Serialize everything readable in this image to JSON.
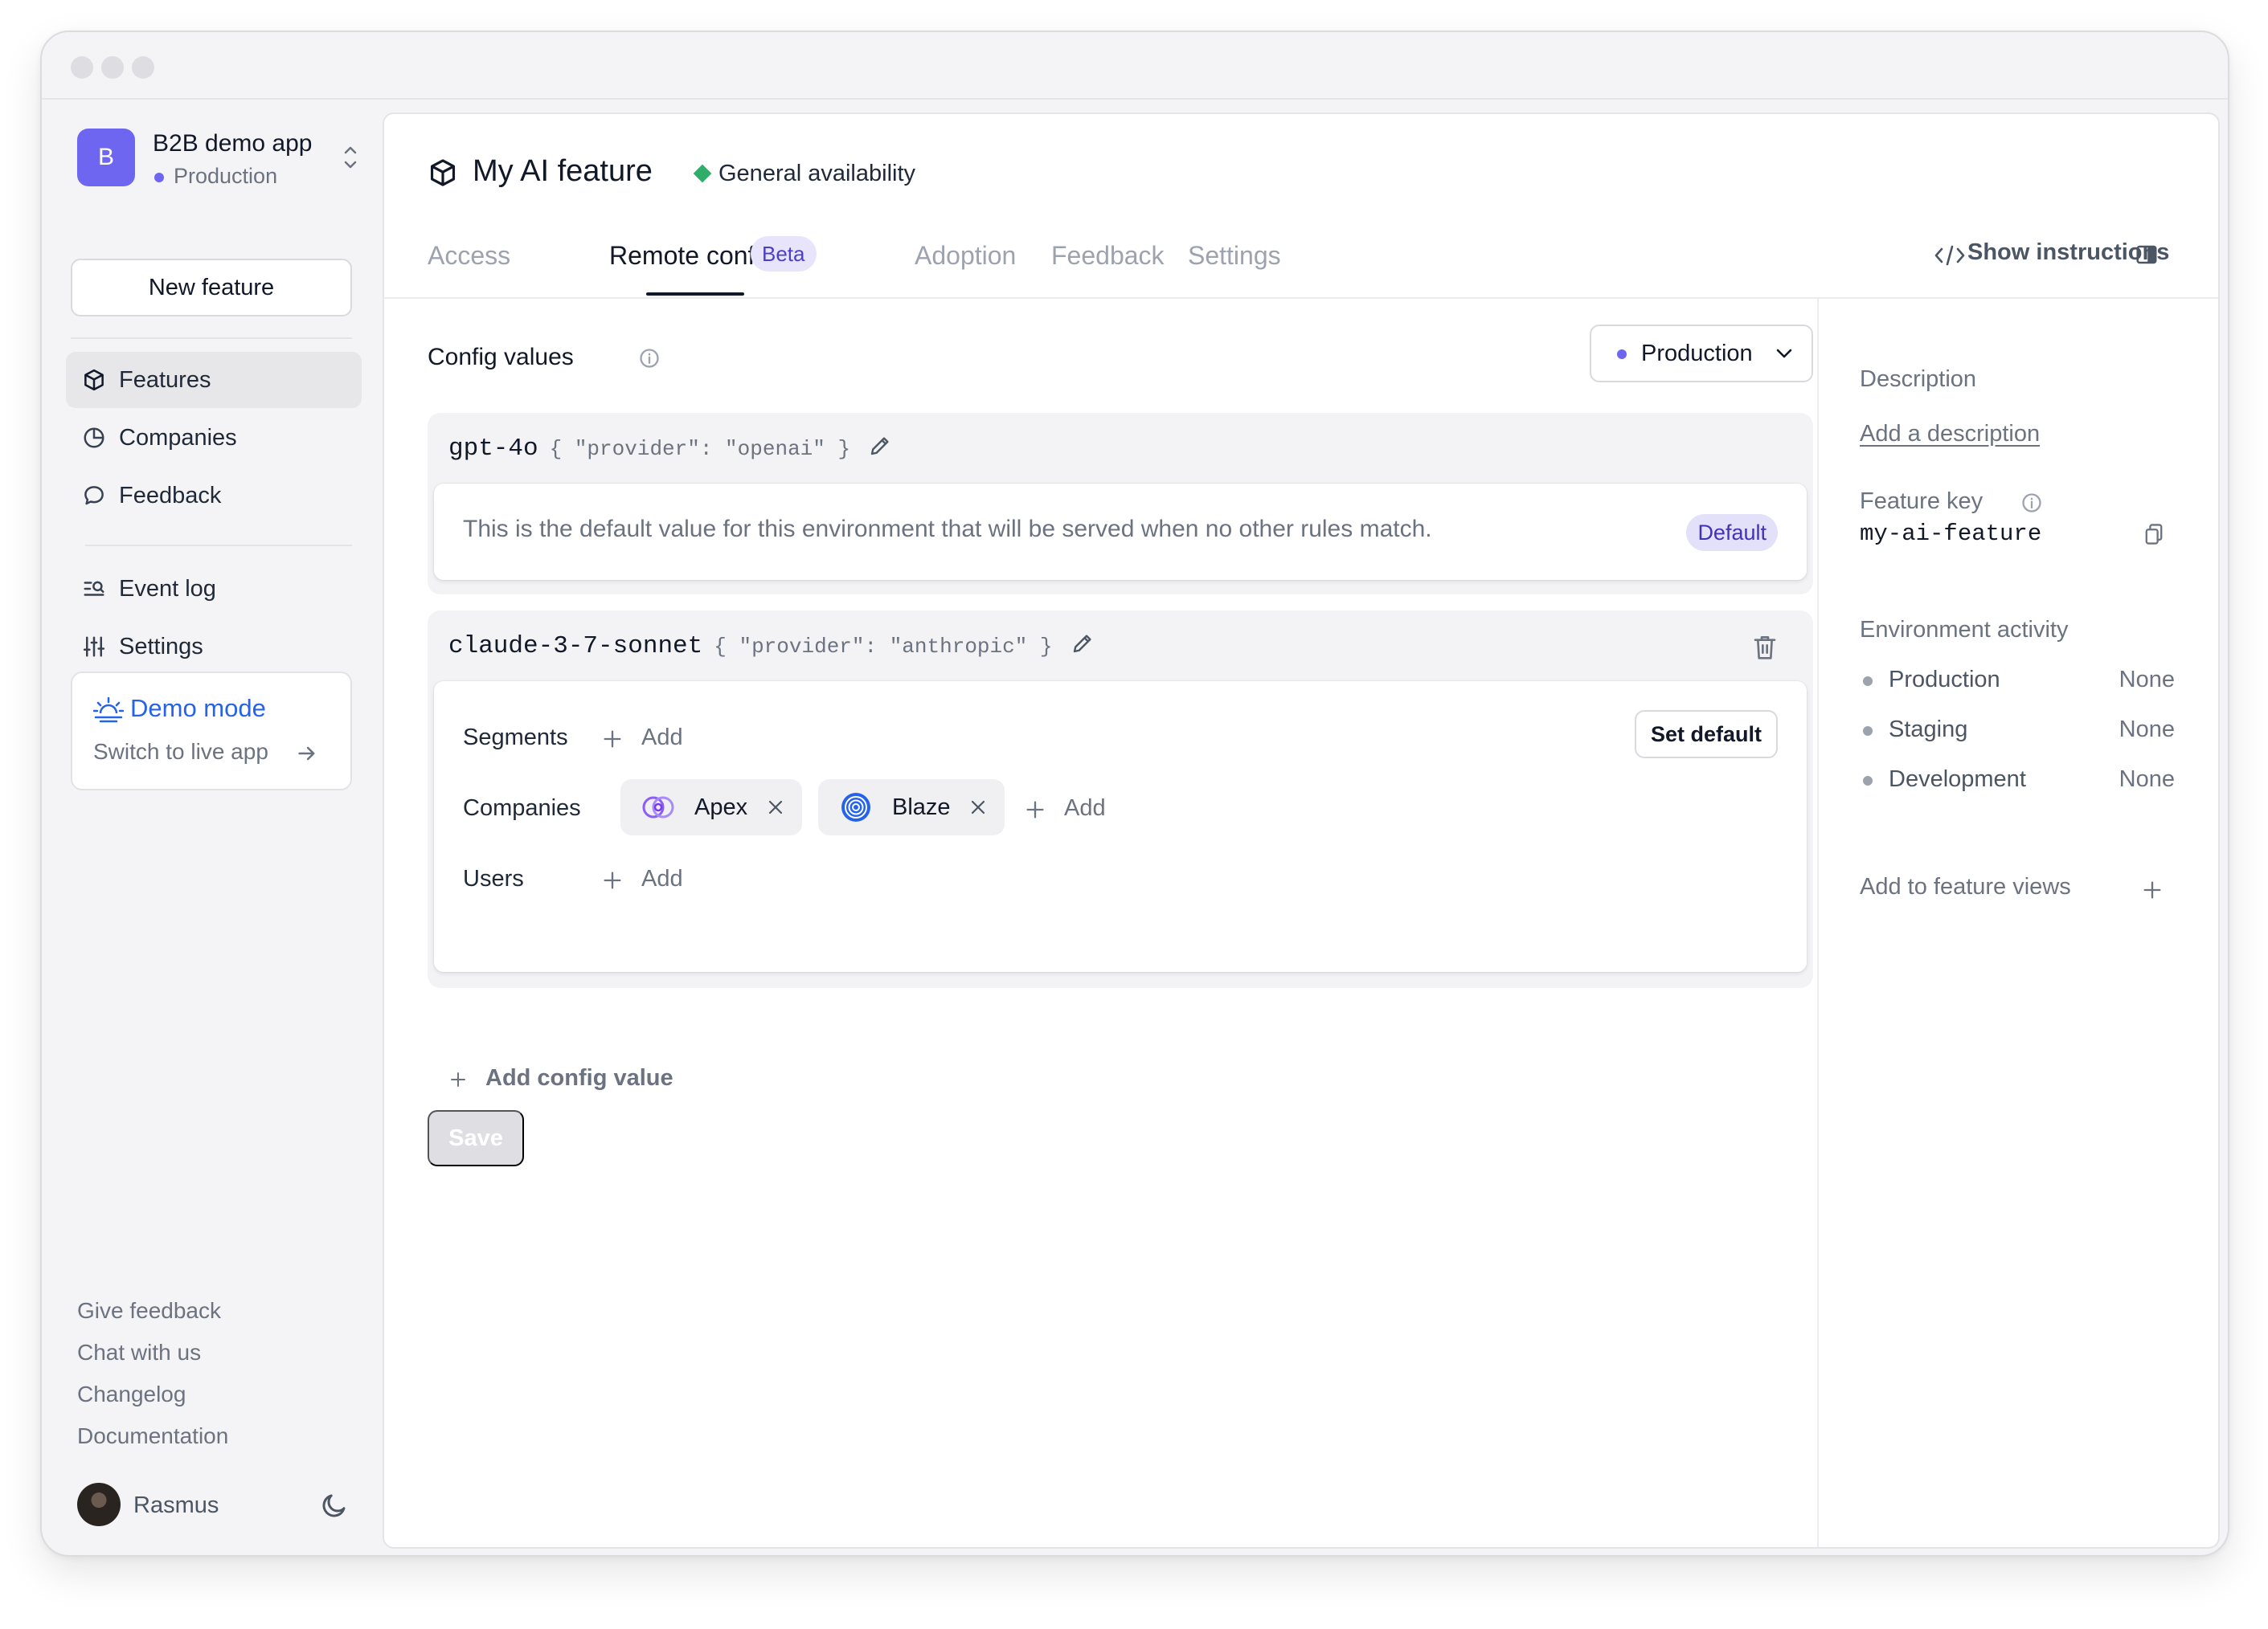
{
  "app": {
    "initial": "B",
    "name": "B2B demo app",
    "env": "Production"
  },
  "sidebar": {
    "new_feature": "New feature",
    "items": [
      {
        "label": "Features",
        "icon": "cube-icon"
      },
      {
        "label": "Companies",
        "icon": "pie-chart-icon"
      },
      {
        "label": "Feedback",
        "icon": "chat-bubble-icon"
      },
      {
        "label": "Event log",
        "icon": "event-log-icon"
      },
      {
        "label": "Settings",
        "icon": "sliders-icon"
      }
    ],
    "demo": {
      "title": "Demo mode",
      "subtitle": "Switch to live app"
    },
    "footer_links": [
      "Give feedback",
      "Chat with us",
      "Changelog",
      "Documentation"
    ],
    "user": {
      "name": "Rasmus"
    }
  },
  "feature": {
    "title": "My AI feature",
    "stage": "General availability"
  },
  "tabs": {
    "items": [
      "Access",
      "Remote config",
      "Adoption",
      "Feedback",
      "Settings"
    ],
    "active": "Remote config",
    "beta": "Beta",
    "show_instructions": "Show instructions"
  },
  "config": {
    "title": "Config values",
    "environment": "Production",
    "values": [
      {
        "key": "gpt-4o",
        "payload": "{ \"provider\": \"openai\" }",
        "default_text": "This is the default value for this environment that will be served when no other rules match.",
        "badge": "Default"
      },
      {
        "key": "claude-3-7-sonnet",
        "payload": "{ \"provider\": \"anthropic\" }",
        "segments_label": "Segments",
        "companies_label": "Companies",
        "users_label": "Users",
        "add_label": "Add",
        "set_default": "Set default",
        "companies": [
          "Apex",
          "Blaze"
        ]
      }
    ],
    "add_config": "Add config value",
    "save": "Save"
  },
  "details": {
    "description_label": "Description",
    "add_description": "Add a description",
    "feature_key_label": "Feature key",
    "feature_key": "my-ai-feature",
    "env_activity_label": "Environment activity",
    "env_activity": [
      {
        "name": "Production",
        "value": "None"
      },
      {
        "name": "Staging",
        "value": "None"
      },
      {
        "name": "Development",
        "value": "None"
      }
    ],
    "add_to_views": "Add to feature views"
  },
  "colors": {
    "accent": "#6e66f0",
    "ga": "#2fae6a",
    "demo": "#2563eb"
  }
}
